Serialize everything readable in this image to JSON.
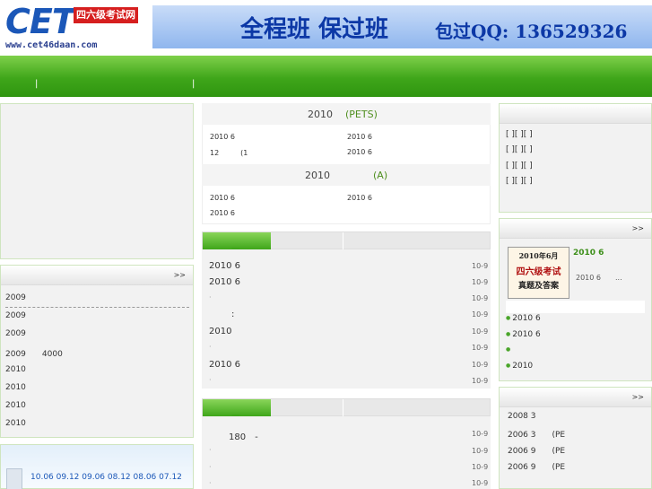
{
  "header": {
    "logo_cet": "CET",
    "logo_cn": "四六级考试网",
    "logo_url": "www.cet46daan.com",
    "banner_text1": "全程班 保过班",
    "banner_text2": "包过QQ: 136529326"
  },
  "nav": {
    "sep1": "|",
    "sep2": "|"
  },
  "left_panel": {
    "more": ">>",
    "items": [
      "2009",
      "2009",
      "2009",
      "2009　　4000",
      "2010",
      "2010",
      "2010",
      "2010"
    ],
    "thumbs": "10.06 09.12 09.06 08.12 08.06 07.12"
  },
  "center": {
    "box1_title_year": "2010",
    "box1_title_tag": "(PETS)",
    "box1_cells": [
      "2010 6",
      "2010 6",
      "12　　　(1",
      "2010 6"
    ],
    "box2_title_year": "2010",
    "box2_title_tag": "(A)",
    "box2_cells": [
      "2010 6",
      "2010 6",
      "2010 6"
    ],
    "list1": [
      {
        "text": "2010 6",
        "date": "10-9"
      },
      {
        "text": "2010 6",
        "date": "10-9"
      },
      {
        "text": "",
        "date": "10-9"
      },
      {
        "text": ":",
        "date": "10-9"
      },
      {
        "text": "2010",
        "date": "10-9"
      },
      {
        "text": "",
        "date": "10-9"
      },
      {
        "text": "2010 6",
        "date": "10-9"
      },
      {
        "text": "",
        "date": "10-9"
      }
    ],
    "list2": [
      {
        "text": "180　-",
        "date": "10-9"
      },
      {
        "text": "",
        "date": "10-9"
      },
      {
        "text": "",
        "date": "10-9"
      },
      {
        "text": "",
        "date": "10-9"
      }
    ]
  },
  "right_panel": {
    "brackets": [
      "[ ][ ][ ]",
      "[ ][ ][ ]",
      "[ ][ ][ ]",
      "[ ][ ][ ]"
    ],
    "more1": ">>",
    "book_title": "2010 6",
    "book_sub": "2010 6　　...",
    "book_img_lines": [
      "2010年6月",
      "四六级考试",
      "真题及答案"
    ],
    "bullets": [
      "2010 6",
      "2010 6",
      "",
      "2010"
    ],
    "more2": ">>",
    "list": [
      "2008 3",
      "2006 3　　(PE",
      "2006 9　　(PE",
      "2006 9　　(PE"
    ]
  }
}
